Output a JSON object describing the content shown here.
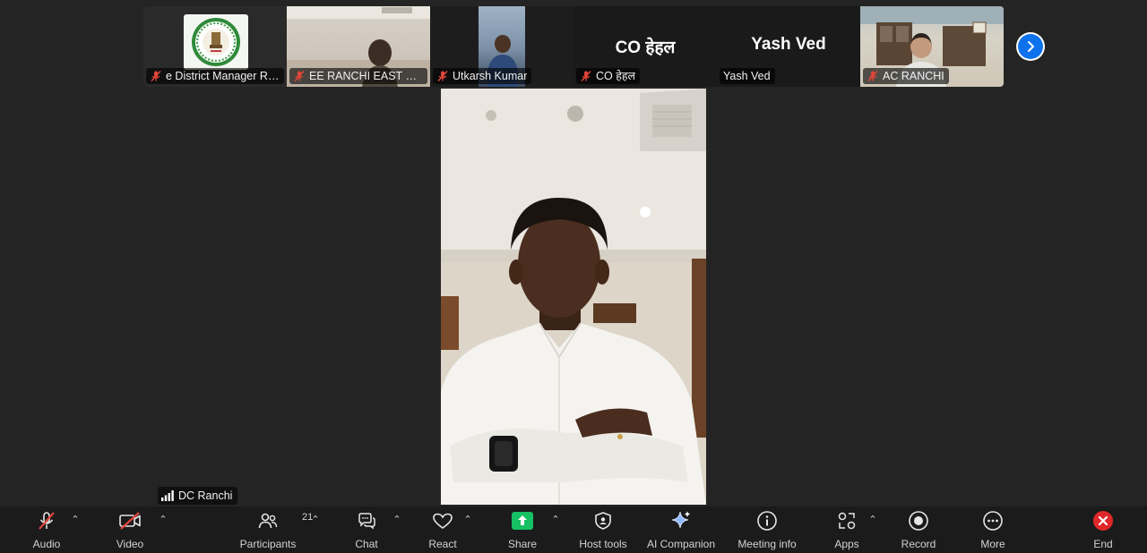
{
  "thumbnails": [
    {
      "name": "e District Manager Ra...",
      "muted": true,
      "kind": "logo"
    },
    {
      "name": "EE RANCHI EAST RAN...",
      "muted": true,
      "kind": "video"
    },
    {
      "name": "Utkarsh Kumar",
      "muted": true,
      "kind": "video"
    },
    {
      "name": "CO हेहल",
      "display_name": "CO हेहल",
      "muted": true,
      "kind": "text"
    },
    {
      "name": "Yash Ved",
      "display_name": "Yash Ved",
      "muted": false,
      "kind": "text"
    },
    {
      "name": "AC RANCHI",
      "muted": true,
      "kind": "video"
    }
  ],
  "active_speaker": {
    "name": "DC Ranchi"
  },
  "toolbar": {
    "audio": {
      "label": "Audio",
      "muted": true
    },
    "video": {
      "label": "Video",
      "off": true
    },
    "participants": {
      "label": "Participants",
      "count": "21"
    },
    "chat": {
      "label": "Chat"
    },
    "react": {
      "label": "React"
    },
    "share": {
      "label": "Share"
    },
    "host_tools": {
      "label": "Host tools"
    },
    "ai_companion": {
      "label": "AI Companion"
    },
    "meeting_info": {
      "label": "Meeting info"
    },
    "apps": {
      "label": "Apps"
    },
    "record": {
      "label": "Record"
    },
    "more": {
      "label": "More"
    },
    "end": {
      "label": "End"
    }
  },
  "colors": {
    "background": "#242424",
    "toolbar": "#1b1b1b",
    "share_green": "#16c064",
    "end_red": "#e02828",
    "accent_blue": "#0e72ed",
    "muted_red": "#e0453a"
  }
}
